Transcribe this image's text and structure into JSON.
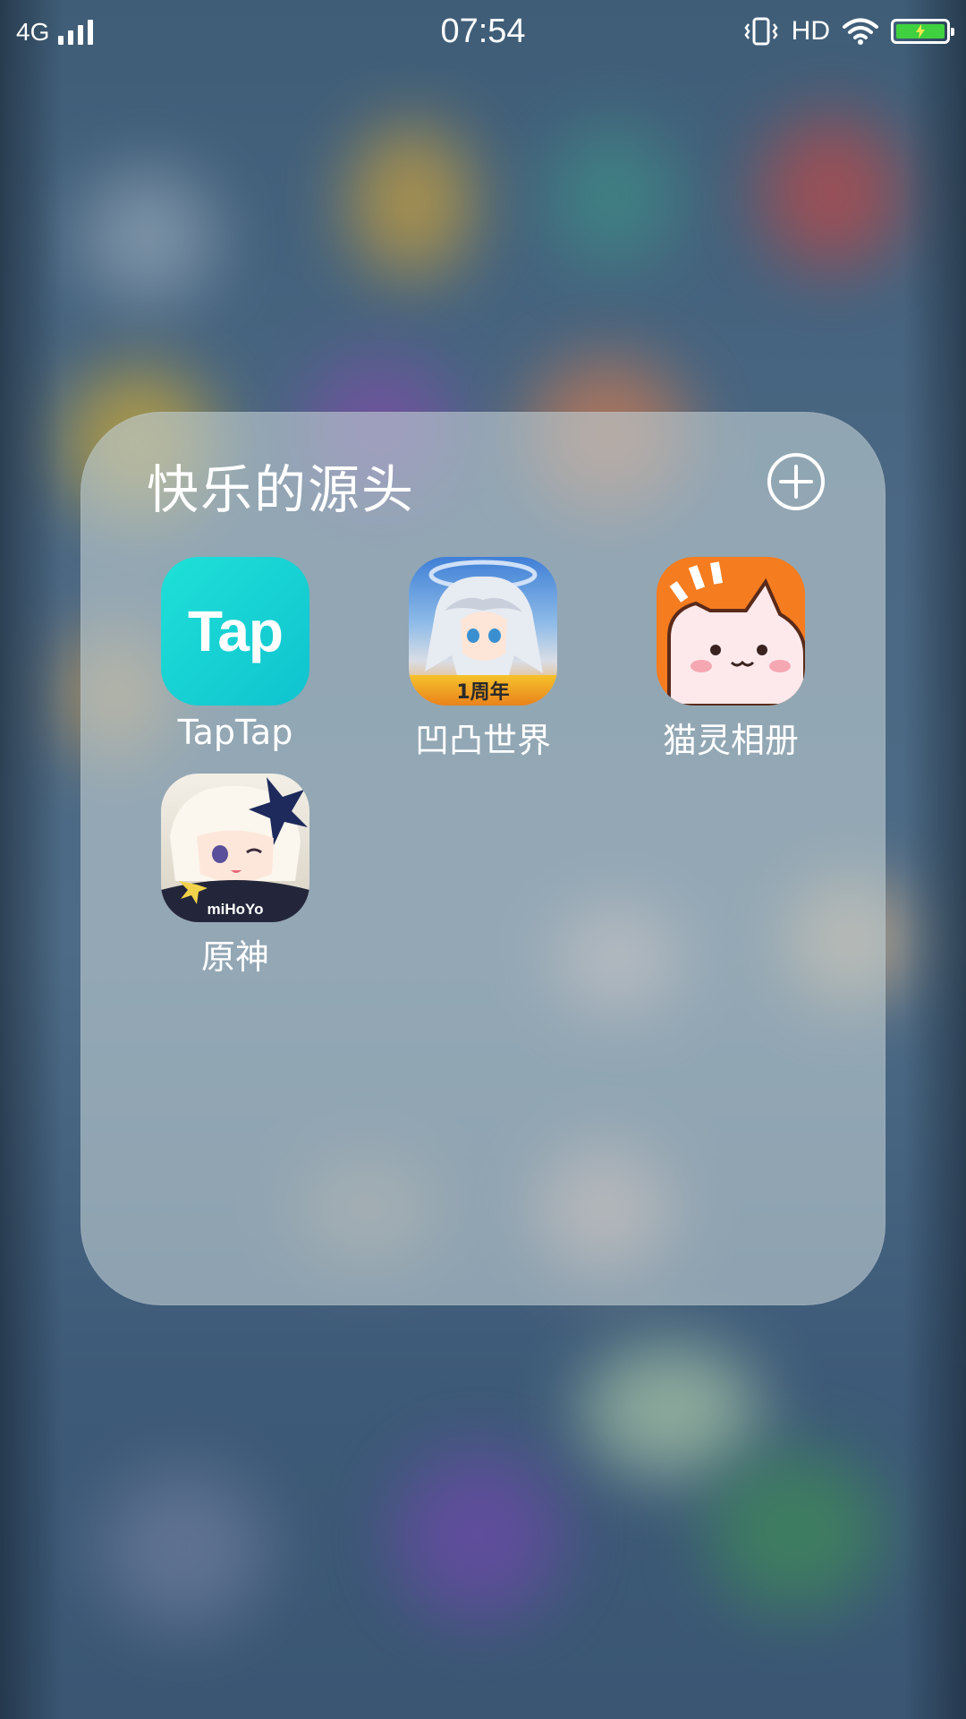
{
  "status_bar": {
    "network_type": "4G",
    "time": "07:54",
    "hd_label": "HD",
    "icons": [
      "signal-icon",
      "vibrate-icon",
      "wifi-icon",
      "battery-charging-icon"
    ],
    "battery_color": "#3fd13f"
  },
  "folder": {
    "title": "快乐的源头",
    "add_icon": "plus-circle-icon",
    "apps": [
      {
        "label": "TapTap",
        "icon": "taptap-icon",
        "icon_text": "Tap",
        "color": "#16d6d4"
      },
      {
        "label": "凹凸世界",
        "icon": "aotu-world-icon",
        "badge_text": "1周年",
        "color": "#4f8fd6"
      },
      {
        "label": "猫灵相册",
        "icon": "cat-album-icon",
        "color": "#f57c1f"
      },
      {
        "label": "原神",
        "icon": "genshin-icon",
        "brand_text": "miHoYo",
        "color": "#d8d3c8"
      }
    ]
  }
}
